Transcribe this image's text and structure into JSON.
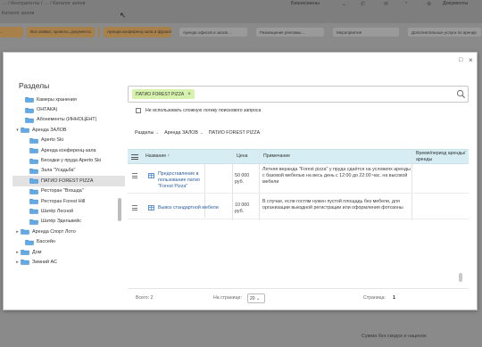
{
  "background": {
    "breadcrumb": "… / Контрагенты / … / Каталог залов",
    "subtitle": "Каталог залов",
    "user_label": "Бизнесмены",
    "docs_label": "Документы",
    "bottom_text": "Сумма без скидок и наценок",
    "tabs": [
      {
        "label": "…",
        "style": "orange"
      },
      {
        "label": "Все заявки, проекты, документы",
        "style": "orange"
      },
      {
        "label": "…",
        "style": "orange"
      },
      {
        "label": "Аренда конференц-зала и фуршет…",
        "style": "orange"
      },
      {
        "label": "Аренда офисов и залов…",
        "style": "grey"
      },
      {
        "label": "Размещение рекламы…",
        "style": "grey"
      },
      {
        "label": "Мероприятия",
        "style": "grey"
      },
      {
        "label": "Дополнительные услуги по аренде",
        "style": "grey"
      }
    ]
  },
  "modal": {
    "window_controls": {
      "maximize": "□",
      "close": "×"
    },
    "sidebar": {
      "title": "Разделы",
      "items": [
        {
          "label": "Камеры хранения",
          "arrow": "",
          "indent": 1,
          "selected": false
        },
        {
          "label": "ОНТАКА)",
          "arrow": "",
          "indent": 1,
          "selected": false
        },
        {
          "label": "Абонементы (ИННОЦЕНТ)",
          "arrow": "",
          "indent": 1,
          "selected": false
        },
        {
          "label": "Аренда ЗАЛОВ",
          "arrow": "▾",
          "indent": 0,
          "selected": false
        },
        {
          "label": "Aperto Ski",
          "arrow": "",
          "indent": 2,
          "selected": false
        },
        {
          "label": "Аренда конференц-зала",
          "arrow": "",
          "indent": 2,
          "selected": false
        },
        {
          "label": "Беседки у пруда Aperto Ski",
          "arrow": "",
          "indent": 2,
          "selected": false
        },
        {
          "label": "Зала \"Усадьба\"",
          "arrow": "",
          "indent": 2,
          "selected": false
        },
        {
          "label": "ПАТИО FOREST PIZZA",
          "arrow": "",
          "indent": 2,
          "selected": true
        },
        {
          "label": "Ресторан \"Вгошда\"",
          "arrow": "",
          "indent": 2,
          "selected": false
        },
        {
          "label": "Ресторан Forest Hill",
          "arrow": "",
          "indent": 2,
          "selected": false
        },
        {
          "label": "Шатёр Лесной",
          "arrow": "",
          "indent": 2,
          "selected": false
        },
        {
          "label": "Шатёр Эдельвейс",
          "arrow": "",
          "indent": 2,
          "selected": false
        },
        {
          "label": "Аренда Спорт Лото",
          "arrow": "▸",
          "indent": 0,
          "selected": false
        },
        {
          "label": "Бассейн",
          "arrow": "",
          "indent": 1,
          "selected": false
        },
        {
          "label": "Дом",
          "arrow": "▸",
          "indent": 0,
          "selected": false
        },
        {
          "label": "Зимний АС",
          "arrow": "▸",
          "indent": 0,
          "selected": false
        }
      ]
    },
    "search": {
      "chip_label": "ПАТИО FOREST PIZZA",
      "chip_close": "×"
    },
    "checkbox_label": "Не использовать сложную логику поискового запроса",
    "breadcrumbs": [
      {
        "label": "Разделы",
        "caret": "⌄"
      },
      {
        "label": "Аренда ЗАЛОВ",
        "caret": "⌄"
      },
      {
        "label": "ПАТИО FOREST PIZZA",
        "caret": ""
      }
    ],
    "table": {
      "headers": {
        "name": "Название ↑",
        "price": "Цена",
        "note": "Примечание",
        "time": "Время/период аренды/ аренды"
      },
      "rows": [
        {
          "name": "Предоставление в пользование патио \"Forest Pizza\"",
          "price": "50 000 руб.",
          "note": "Летняя веранда \"Forest pizza\" у пруда сдаётся на условиях аренды с базовой мебелью на весь день с 12:00 до 22:00 час. на высокой мебели"
        },
        {
          "name": "Вывоз стандартной мебели",
          "price": "10 000 руб.",
          "note": "В случае, если гостям нужен пустой площадь без мебели, для организации выездной регистрации или оформления фотозоны"
        }
      ],
      "footer": {
        "total_label": "Всего: 2",
        "per_page_label": "На странице:",
        "per_page_value": "20",
        "pages_label": "Страница:",
        "current_page": "1"
      }
    }
  }
}
